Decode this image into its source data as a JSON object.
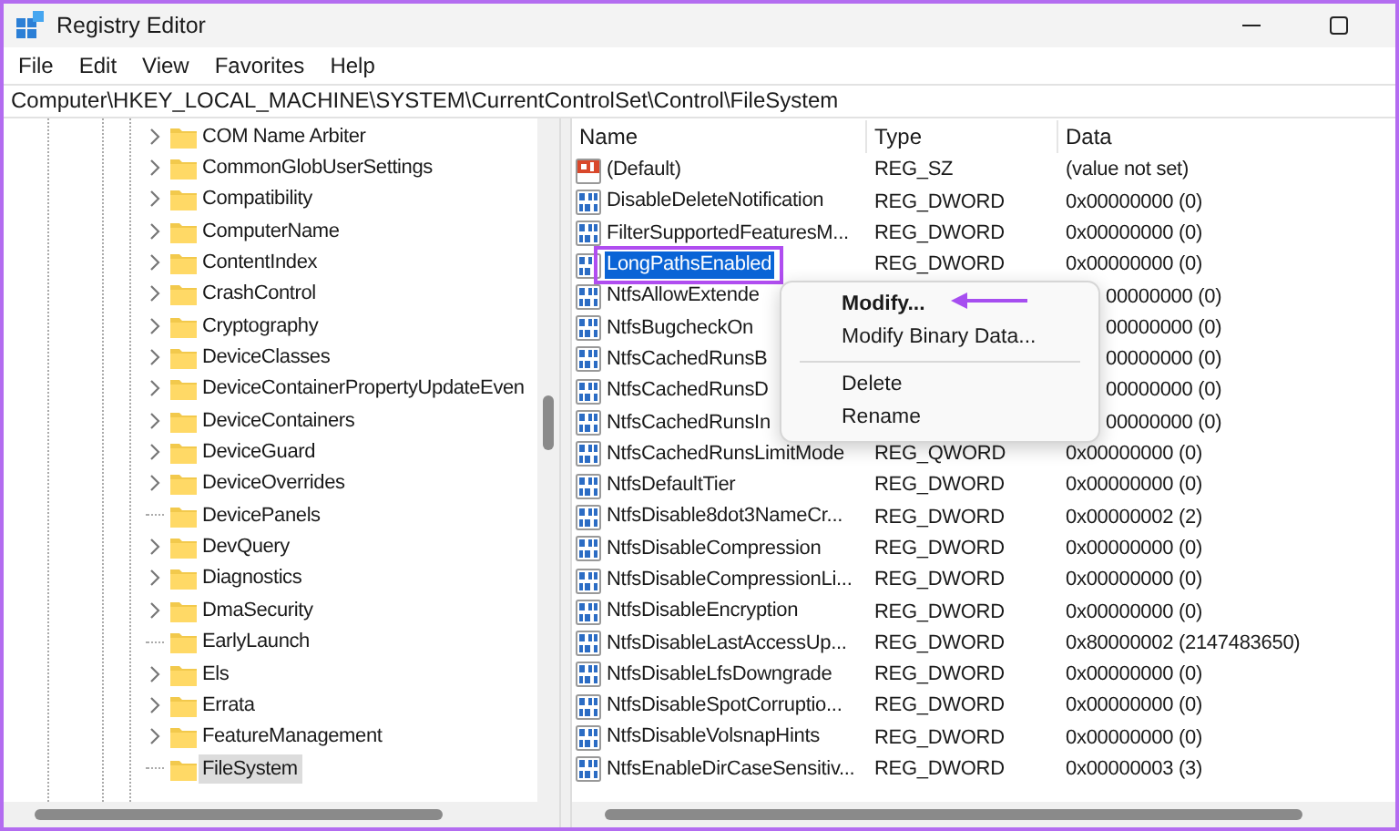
{
  "window": {
    "title": "Registry Editor"
  },
  "menu": [
    "File",
    "Edit",
    "View",
    "Favorites",
    "Help"
  ],
  "address": "Computer\\HKEY_LOCAL_MACHINE\\SYSTEM\\CurrentControlSet\\Control\\FileSystem",
  "tree": [
    {
      "label": "COM Name Arbiter",
      "expandable": true,
      "selected": false
    },
    {
      "label": "CommonGlobUserSettings",
      "expandable": true,
      "selected": false
    },
    {
      "label": "Compatibility",
      "expandable": true,
      "selected": false
    },
    {
      "label": "ComputerName",
      "expandable": true,
      "selected": false
    },
    {
      "label": "ContentIndex",
      "expandable": true,
      "selected": false
    },
    {
      "label": "CrashControl",
      "expandable": true,
      "selected": false
    },
    {
      "label": "Cryptography",
      "expandable": true,
      "selected": false
    },
    {
      "label": "DeviceClasses",
      "expandable": true,
      "selected": false
    },
    {
      "label": "DeviceContainerPropertyUpdateEven",
      "expandable": true,
      "selected": false
    },
    {
      "label": "DeviceContainers",
      "expandable": true,
      "selected": false
    },
    {
      "label": "DeviceGuard",
      "expandable": true,
      "selected": false
    },
    {
      "label": "DeviceOverrides",
      "expandable": true,
      "selected": false
    },
    {
      "label": "DevicePanels",
      "expandable": false,
      "selected": false
    },
    {
      "label": "DevQuery",
      "expandable": true,
      "selected": false
    },
    {
      "label": "Diagnostics",
      "expandable": true,
      "selected": false
    },
    {
      "label": "DmaSecurity",
      "expandable": true,
      "selected": false
    },
    {
      "label": "EarlyLaunch",
      "expandable": false,
      "selected": false
    },
    {
      "label": "Els",
      "expandable": true,
      "selected": false
    },
    {
      "label": "Errata",
      "expandable": true,
      "selected": false
    },
    {
      "label": "FeatureManagement",
      "expandable": true,
      "selected": false
    },
    {
      "label": "FileSystem",
      "expandable": false,
      "selected": true
    }
  ],
  "values": {
    "columns": [
      "Name",
      "Type",
      "Data"
    ],
    "rows": [
      {
        "kind": "string",
        "name": "(Default)",
        "type": "REG_SZ",
        "data": "(value not set)",
        "selected": false
      },
      {
        "kind": "number",
        "name": "DisableDeleteNotification",
        "type": "REG_DWORD",
        "data": "0x00000000 (0)",
        "selected": false
      },
      {
        "kind": "number",
        "name": "FilterSupportedFeaturesM...",
        "type": "REG_DWORD",
        "data": "0x00000000 (0)",
        "selected": false
      },
      {
        "kind": "number",
        "name": "LongPathsEnabled",
        "type": "REG_DWORD",
        "data": "0x00000000 (0)",
        "selected": true
      },
      {
        "kind": "number",
        "name": "NtfsAllowExtende",
        "data": "00000000 (0)",
        "selected": false
      },
      {
        "kind": "number",
        "name": "NtfsBugcheckOn",
        "data": "00000000 (0)",
        "selected": false
      },
      {
        "kind": "number",
        "name": "NtfsCachedRunsB",
        "data": "00000000 (0)",
        "selected": false
      },
      {
        "kind": "number",
        "name": "NtfsCachedRunsD",
        "data": "00000000 (0)",
        "selected": false
      },
      {
        "kind": "number",
        "name": "NtfsCachedRunsIn",
        "data": "00000000 (0)",
        "selected": false
      },
      {
        "kind": "number",
        "name": "NtfsCachedRunsLimitMode",
        "type": "REG_QWORD",
        "data": "0x00000000 (0)",
        "selected": false
      },
      {
        "kind": "number",
        "name": "NtfsDefaultTier",
        "type": "REG_DWORD",
        "data": "0x00000000 (0)",
        "selected": false
      },
      {
        "kind": "number",
        "name": "NtfsDisable8dot3NameCr...",
        "type": "REG_DWORD",
        "data": "0x00000002 (2)",
        "selected": false
      },
      {
        "kind": "number",
        "name": "NtfsDisableCompression",
        "type": "REG_DWORD",
        "data": "0x00000000 (0)",
        "selected": false
      },
      {
        "kind": "number",
        "name": "NtfsDisableCompressionLi...",
        "type": "REG_DWORD",
        "data": "0x00000000 (0)",
        "selected": false
      },
      {
        "kind": "number",
        "name": "NtfsDisableEncryption",
        "type": "REG_DWORD",
        "data": "0x00000000 (0)",
        "selected": false
      },
      {
        "kind": "number",
        "name": "NtfsDisableLastAccessUp...",
        "type": "REG_DWORD",
        "data": "0x80000002 (2147483650)",
        "selected": false
      },
      {
        "kind": "number",
        "name": "NtfsDisableLfsDowngrade",
        "type": "REG_DWORD",
        "data": "0x00000000 (0)",
        "selected": false
      },
      {
        "kind": "number",
        "name": "NtfsDisableSpotCorruptio...",
        "type": "REG_DWORD",
        "data": "0x00000000 (0)",
        "selected": false
      },
      {
        "kind": "number",
        "name": "NtfsDisableVolsnapHints",
        "type": "REG_DWORD",
        "data": "0x00000000 (0)",
        "selected": false
      },
      {
        "kind": "number",
        "name": "NtfsEnableDirCaseSensitiv...",
        "type": "REG_DWORD",
        "data": "0x00000003 (3)",
        "selected": false
      }
    ]
  },
  "context_menu": [
    {
      "kind": "item",
      "label": "Modify...",
      "default": true
    },
    {
      "kind": "item",
      "label": "Modify Binary Data...",
      "default": false
    },
    {
      "kind": "separator"
    },
    {
      "kind": "item",
      "label": "Delete",
      "default": false
    },
    {
      "kind": "item",
      "label": "Rename",
      "default": false
    }
  ]
}
